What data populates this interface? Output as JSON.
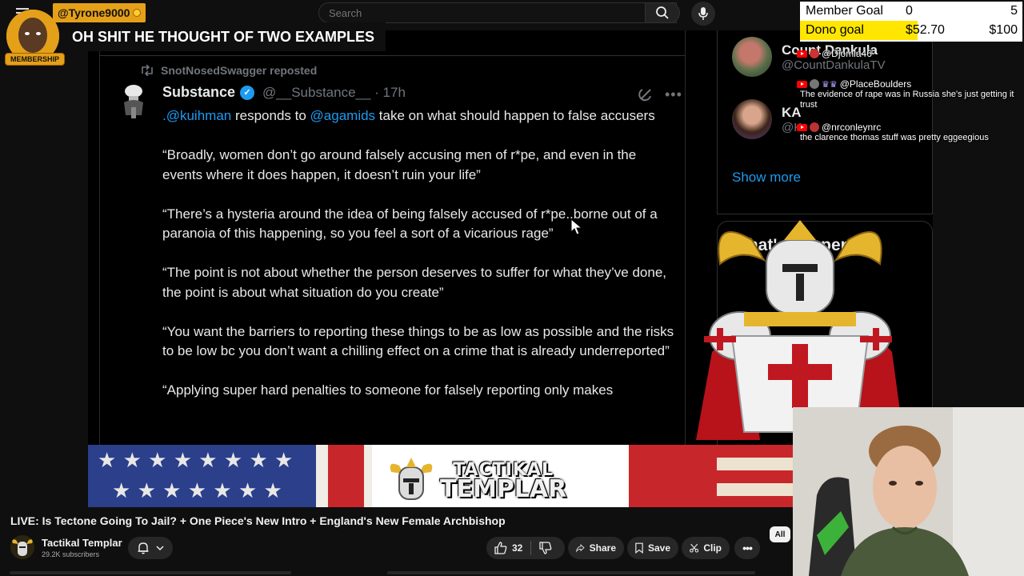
{
  "search": {
    "placeholder": "Search"
  },
  "superchat": {
    "username": "@Tyrone9000",
    "badge": "MEMBERSHIP",
    "message": "OH SHIT HE THOUGHT OF TWO EXAMPLES"
  },
  "goals": {
    "member_label": "Member Goal",
    "member_current": "0",
    "member_target": "5",
    "dono_label": "Dono goal",
    "dono_current": "$52.70",
    "dono_target": "$100",
    "dono_progress": 0.527
  },
  "chat": [
    {
      "user": "@Djomla46",
      "text": ""
    },
    {
      "user": "@PlaceBoulders",
      "text": "The evidence of rape was in Russia she's just getting it trust"
    },
    {
      "user": "@nrconleynrc",
      "text": "the clarence thomas stuff was pretty eggeegious"
    }
  ],
  "tweet": {
    "repost_label": "SnotNosedSwagger reposted",
    "author_name": "Substance",
    "author_handle": "@__Substance__ · 17h",
    "intro_mention1": ".@kuihman",
    "intro_mid": " responds to ",
    "intro_mention2": "@agamids",
    "intro_end": " take on what should happen to false accusers",
    "quotes": [
      "“Broadly, women don’t go around falsely accusing men of r*pe, and even in the events where it does happen, it doesn’t ruin your life”",
      "“There’s a hysteria around the idea of being falsely accused of r*pe..borne out of a paranoia of this happening, so you feel a sort of a vicarious rage”",
      "“The point is not about whether the person deserves to suffer for what they’ve done, the point is about what situation do you create”",
      "“You want the barriers to reporting these things to be as low as possible and the risks to be low bc you don’t want a chilling effect on a crime that is already underreported”",
      "“Applying super hard penalties to someone for falsely reporting only makes"
    ]
  },
  "sidebar": {
    "who1_name": "Count Dankula",
    "who1_handle": "@CountDankulaTV",
    "who2_name": "KA",
    "who2_handle": "@K",
    "show_more": "Show more",
    "happening_title": "What's happening"
  },
  "banner": {
    "brand_line1": "TACTIKAL",
    "brand_line2": "TEMPLAR"
  },
  "video": {
    "title": "LIVE: Is Tectone Going To Jail? + One Piece's New Intro + England's New Female Archbishop",
    "channel": "Tactikal Templar",
    "subscribers": "29.2K subscribers",
    "likes": "32",
    "share_label": "Share",
    "save_label": "Save",
    "clip_label": "Clip",
    "chip_all": "All"
  },
  "colors": {
    "accent_blue": "#1d9bf0",
    "superchat_gold": "#e5a019",
    "dono_yellow": "#ffe600"
  }
}
